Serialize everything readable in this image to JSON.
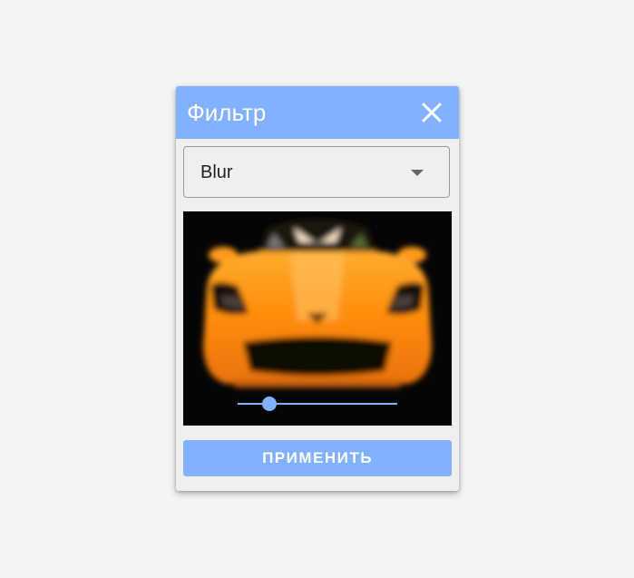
{
  "dialog": {
    "title": "Фильтр",
    "close_icon": "close-icon",
    "accent_color": "#82b1ff"
  },
  "filter_select": {
    "selected": "Blur"
  },
  "preview": {
    "image": "orange-sports-car-front-blurred",
    "blur_slider": {
      "value_fraction": 0.2
    }
  },
  "apply_button": {
    "label": "ПРИМЕНИТЬ"
  }
}
